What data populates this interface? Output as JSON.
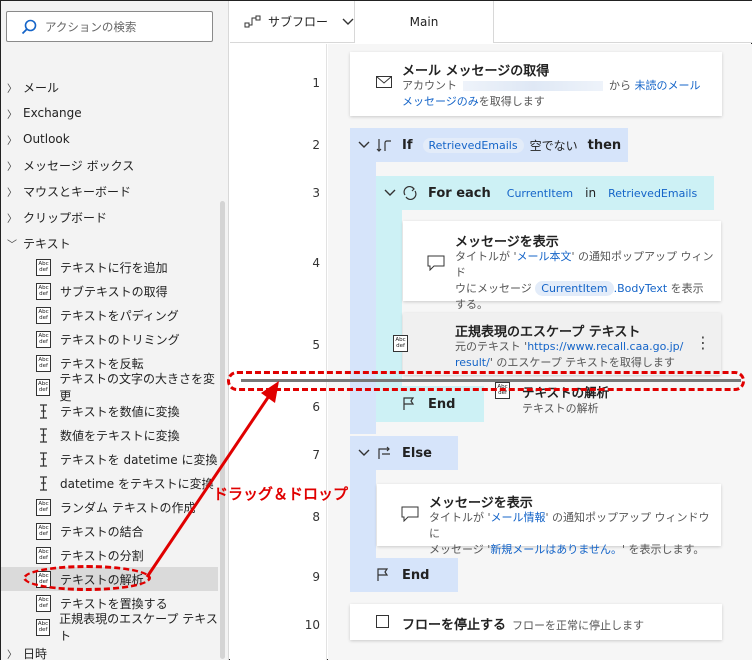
{
  "search": {
    "placeholder": "アクションの検索"
  },
  "categories": {
    "mail": "メール",
    "exchange": "Exchange",
    "outlook": "Outlook",
    "message_box": "メッセージ ボックス",
    "mouse_keyboard": "マウスとキーボード",
    "clipboard": "クリップボード",
    "text": "テキスト",
    "datetime": "日時"
  },
  "text_actions": [
    "テキストに行を追加",
    "サブテキストの取得",
    "テキストをパディング",
    "テキストのトリミング",
    "テキストを反転",
    "テキストの文字の大きさを変更",
    "テキストを数値に変換",
    "数値をテキストに変換",
    "テキストを datetime に変換",
    "datetime をテキストに変換",
    "ランダム テキストの作成",
    "テキストの結合",
    "テキストの分割",
    "テキストの解析",
    "テキストを置換する",
    "正規表現のエスケープ テキスト"
  ],
  "action_icon_text": "Abc\ndef",
  "topbar": {
    "subflow": "サブフロー",
    "main_tab": "Main"
  },
  "line_numbers": [
    "1",
    "2",
    "3",
    "4",
    "5",
    "6",
    "7",
    "8",
    "9",
    "10"
  ],
  "flow": {
    "s1": {
      "title": "メール メッセージの取得",
      "d1": "アカウント",
      "d2": "から",
      "d3": "未読のメール",
      "d4": "メッセージのみ",
      "d5": "を取得します"
    },
    "s2": {
      "kw": "If",
      "var": "RetrievedEmails",
      "cond": "空でない",
      "then": "then"
    },
    "s3": {
      "kw": "For each",
      "var": "CurrentItem",
      "in": "in",
      "coll": "RetrievedEmails"
    },
    "s4": {
      "title": "メッセージを表示",
      "d1": "タイトルが '",
      "d2": "メール本文",
      "d3": "' の通知ポップアップ ウィンド",
      "d4": "ウにメッセージ",
      "d5": "CurrentItem",
      "d6": ".BodyText",
      "d7": "を表示",
      "d8": "する。"
    },
    "s5": {
      "title": "正規表現のエスケープ テキスト",
      "d1": "元のテキスト '",
      "d2": "https://www.recall.caa.go.jp/",
      "d3": "result/",
      "d4": "' のエスケープ テキストを取得します"
    },
    "drag_ghost": {
      "title": "テキストの解析",
      "desc": "テキストの解析"
    },
    "s6": {
      "kw": "End"
    },
    "s7": {
      "kw": "Else"
    },
    "s8": {
      "title": "メッセージを表示",
      "d1": "タイトルが '",
      "d2": "メール情報",
      "d3": "' の通知ポップアップ ウィンドウに",
      "d4": "メッセージ '",
      "d5": "新規メールはありません。",
      "d6": "' を表示します。"
    },
    "s9": {
      "kw": "End"
    },
    "s10": {
      "title": "フローを停止する",
      "desc": "フローを正常に停止します"
    }
  },
  "annotation": {
    "drag_drop_label": "ドラッグ＆ドロップ"
  },
  "colors": {
    "accent": "#1464c8",
    "annotation": "#e00000",
    "if_block": "#d6e4fa",
    "loop_block": "#cdf1f5"
  }
}
